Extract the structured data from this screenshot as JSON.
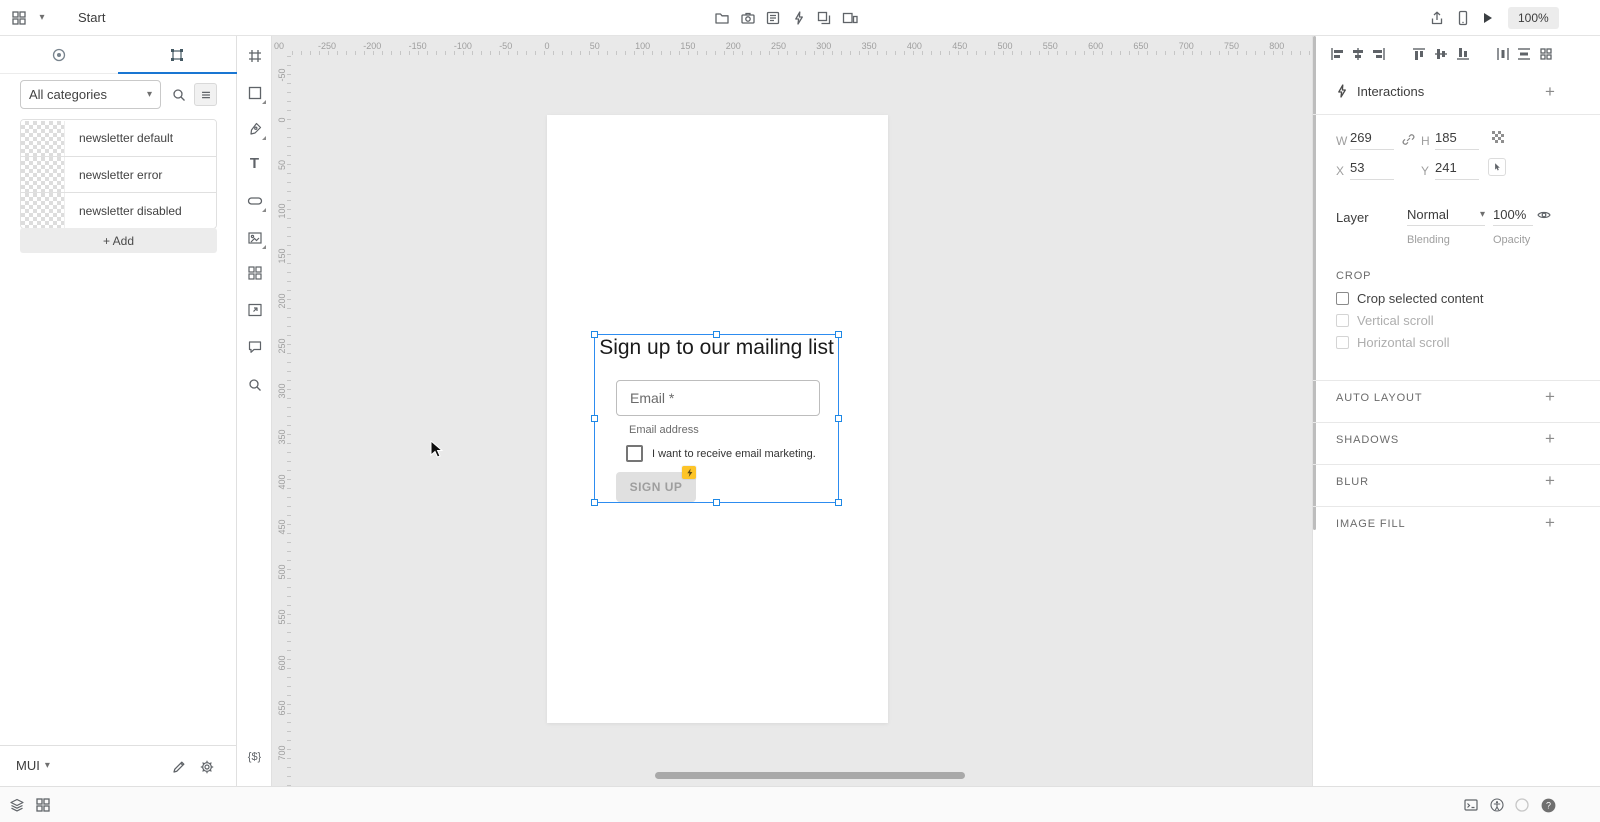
{
  "topbar": {
    "title": "Start",
    "zoom_value": "100%"
  },
  "glyphs": {
    "caret_down": "▾",
    "plus": "+",
    "text_tool": "T",
    "tokens": "{$}",
    "help": "?"
  },
  "left_panel": {
    "categories_value": "All categories",
    "items": [
      {
        "label": "newsletter default"
      },
      {
        "label": "newsletter error"
      },
      {
        "label": "newsletter disabled"
      }
    ],
    "add_label": "+ Add",
    "library_value": "MUI"
  },
  "canvas": {
    "ruler_h": [
      "00",
      "-250",
      "-200",
      "-150",
      "-100",
      "-50",
      "0",
      "50",
      "100",
      "150",
      "200",
      "250",
      "300",
      "350",
      "400",
      "450",
      "500",
      "550",
      "600",
      "650",
      "700",
      "750",
      "800"
    ],
    "ruler_v": [
      "-50",
      "0",
      "50",
      "100",
      "150",
      "200",
      "250",
      "300",
      "350",
      "400",
      "450",
      "500",
      "550",
      "600",
      "650",
      "700"
    ],
    "component": {
      "heading": "Sign up to our mailing list",
      "email_label": "Email *",
      "helper_text": "Email address",
      "checkbox_label": "I want to receive email marketing.",
      "button_label": "SIGN UP"
    }
  },
  "right_panel": {
    "interactions_title": "Interactions",
    "dimensions": {
      "w_label": "W",
      "w_value": "269",
      "h_label": "H",
      "h_value": "185",
      "x_label": "X",
      "x_value": "53",
      "y_label": "Y",
      "y_value": "241"
    },
    "layer": {
      "label": "Layer",
      "blending_value": "Normal",
      "blending_caption": "Blending",
      "opacity_value": "100%",
      "opacity_caption": "Opacity"
    },
    "crop": {
      "title": "CROP",
      "options": [
        {
          "label": "Crop selected content",
          "enabled": true
        },
        {
          "label": "Vertical scroll",
          "enabled": false
        },
        {
          "label": "Horizontal scroll",
          "enabled": false
        }
      ]
    },
    "sections": [
      {
        "label": "AUTO LAYOUT"
      },
      {
        "label": "SHADOWS"
      },
      {
        "label": "BLUR"
      },
      {
        "label": "IMAGE FILL"
      }
    ]
  },
  "colors": {
    "selection_blue": "#2d8cf0",
    "accent_blue": "#1976d2",
    "badge_yellow": "#fdc428"
  }
}
